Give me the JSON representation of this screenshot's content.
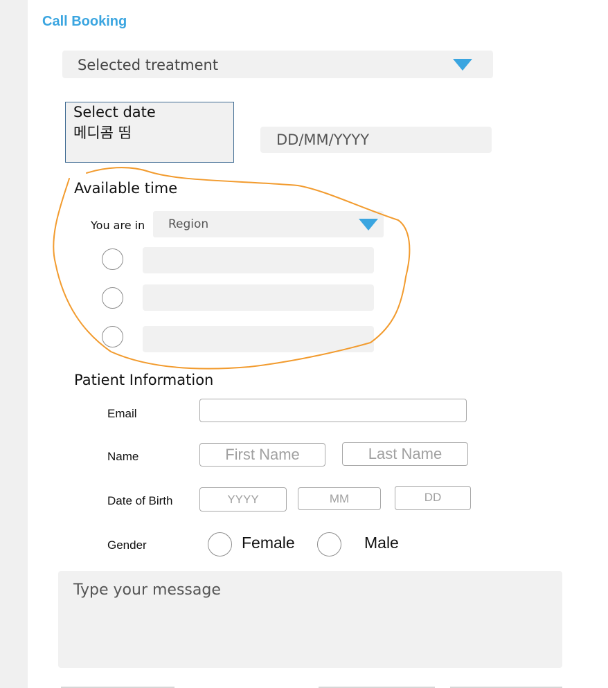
{
  "page": {
    "title": "Call Booking"
  },
  "treatment": {
    "value": "Selected treatment"
  },
  "date_select": {
    "line1": "Select date",
    "line2": "메디콤 띰"
  },
  "date_input": {
    "placeholder": "DD/MM/YYYY"
  },
  "available_time": {
    "heading": "Available time",
    "region_label": "You are in",
    "region_value": "Region",
    "slots": [
      "",
      "",
      ""
    ]
  },
  "patient": {
    "heading": "Patient Information",
    "email_label": "Email",
    "name_label": "Name",
    "first_name_placeholder": "First Name",
    "last_name_placeholder": "Last Name",
    "dob_label": "Date of Birth",
    "dob_year_placeholder": "YYYY",
    "dob_month_placeholder": "MM",
    "dob_day_placeholder": "DD",
    "gender_label": "Gender",
    "gender_female": "Female",
    "gender_male": "Male"
  },
  "message": {
    "placeholder": "Type your message"
  },
  "colors": {
    "accent": "#3aa5e0",
    "annotation": "#f29b2e",
    "field_bg": "#f1f1f1"
  }
}
